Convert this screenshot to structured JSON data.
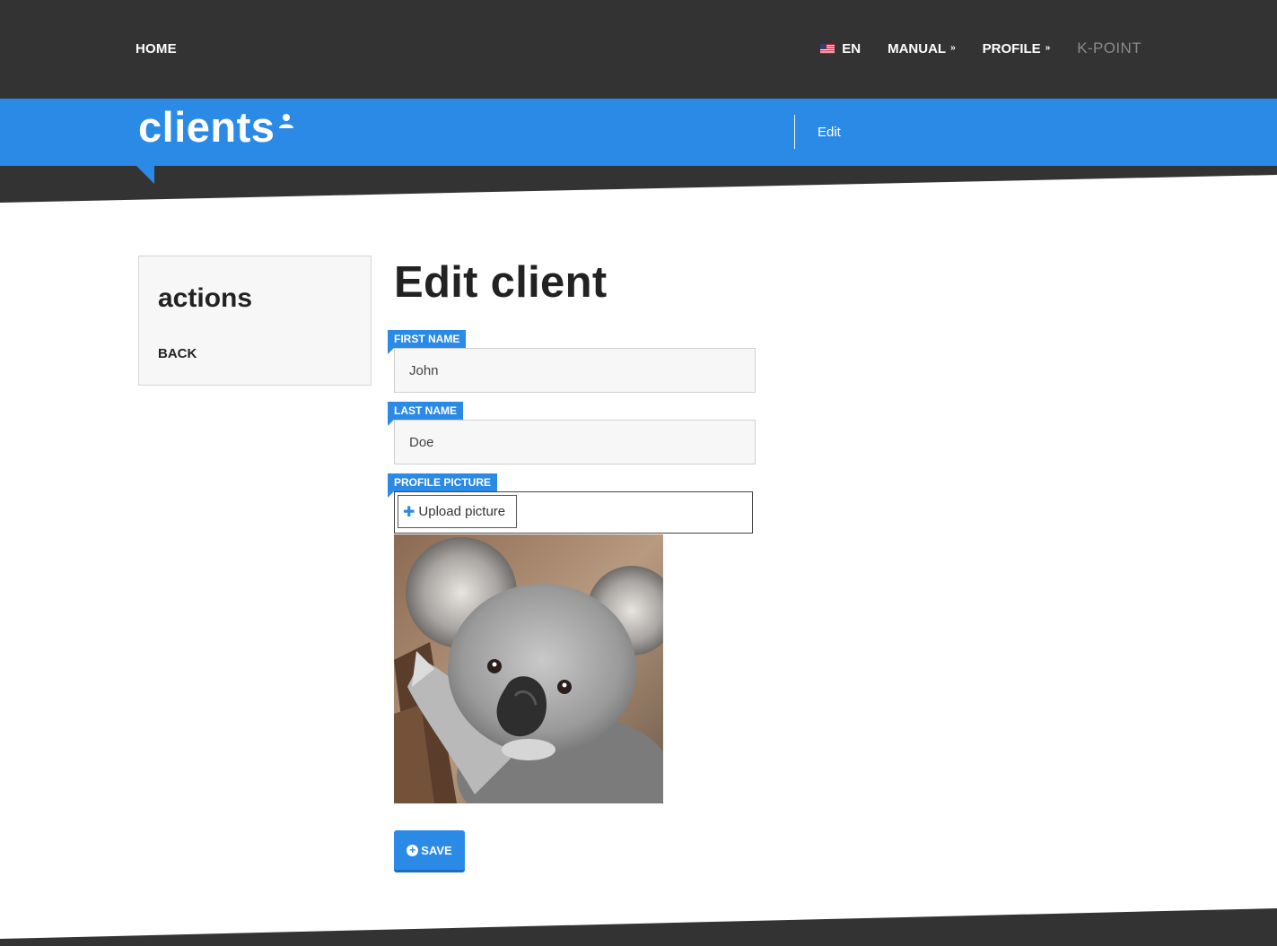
{
  "nav": {
    "home": "HOME",
    "language": "EN",
    "manual": "MANUAL",
    "profile": "PROFILE",
    "brand": "K-POINT"
  },
  "header": {
    "title": "clients",
    "breadcrumb": "Edit"
  },
  "sidebar": {
    "title": "actions",
    "back": "BACK"
  },
  "main": {
    "title": "Edit client",
    "first_name": {
      "label": "FIRST NAME",
      "value": "John"
    },
    "last_name": {
      "label": "LAST NAME",
      "value": "Doe"
    },
    "profile_picture": {
      "label": "PROFILE PICTURE",
      "upload": "Upload picture"
    },
    "save": "SAVE"
  },
  "colors": {
    "accent": "#2b8ae6",
    "dark": "#333333"
  }
}
